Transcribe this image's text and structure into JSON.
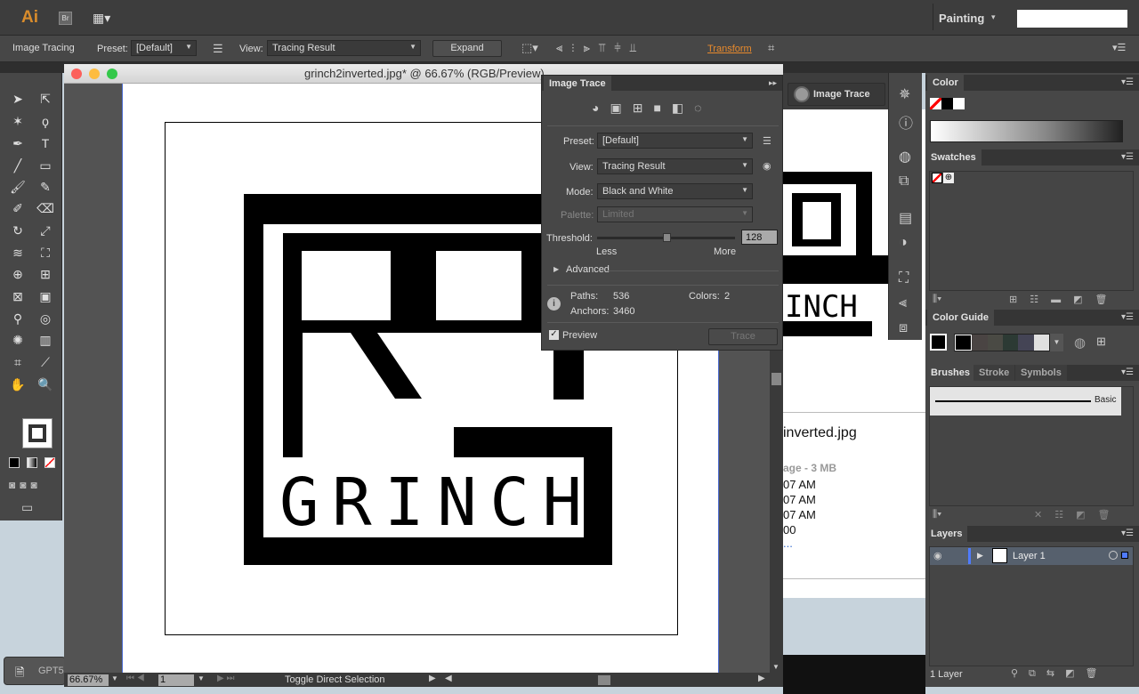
{
  "app": {
    "logo": "Ai",
    "bridge": "Br",
    "workspace": "Painting",
    "search_value": ""
  },
  "control": {
    "label": "Image Tracing",
    "preset_label": "Preset:",
    "preset_value": "[Default]",
    "view_label": "View:",
    "view_value": "Tracing Result",
    "expand": "Expand",
    "transform": "Transform"
  },
  "document": {
    "title": "grinch2inverted.jpg* @ 66.67% (RGB/Preview)",
    "zoom": "66.67%",
    "artboard": "1",
    "status": "Toggle Direct Selection",
    "art_text": "GRINCH"
  },
  "image_trace": {
    "title": "Image Trace",
    "preset_label": "Preset:",
    "preset_value": "[Default]",
    "view_label": "View:",
    "view_value": "Tracing Result",
    "mode_label": "Mode:",
    "mode_value": "Black and White",
    "palette_label": "Palette:",
    "palette_value": "Limited",
    "threshold_label": "Threshold:",
    "threshold_value": "128",
    "threshold_min": 0,
    "threshold_max": 255,
    "less": "Less",
    "more": "More",
    "advanced": "Advanced",
    "paths_label": "Paths:",
    "paths": "536",
    "colors_label": "Colors:",
    "colors": "2",
    "anchors_label": "Anchors:",
    "anchors": "3460",
    "preview": "Preview",
    "preview_checked": true,
    "trace": "Trace"
  },
  "collapsed": {
    "image_trace_button": "Image Trace"
  },
  "finder": {
    "filename": "inverted.jpg",
    "kind": "age - 3 MB",
    "lines": [
      "07 AM",
      "07 AM",
      "07 AM",
      "00",
      "..."
    ],
    "art_text": "INCH"
  },
  "panels": {
    "color": {
      "title": "Color"
    },
    "swatches": {
      "title": "Swatches"
    },
    "color_guide": {
      "title": "Color Guide",
      "colors": [
        "#000000",
        "#4a4443",
        "#4a4a44",
        "#2c3a34",
        "#444455",
        "#e0e0e0"
      ]
    },
    "brushes": {
      "tabs": [
        "Brushes",
        "Stroke",
        "Symbols"
      ],
      "brush": "Basic"
    },
    "layers": {
      "title": "Layers",
      "layer": "Layer 1",
      "count": "1 Layer",
      "layer_color": "#4f7bff"
    }
  },
  "taskbar": {
    "item": "GPT5"
  }
}
